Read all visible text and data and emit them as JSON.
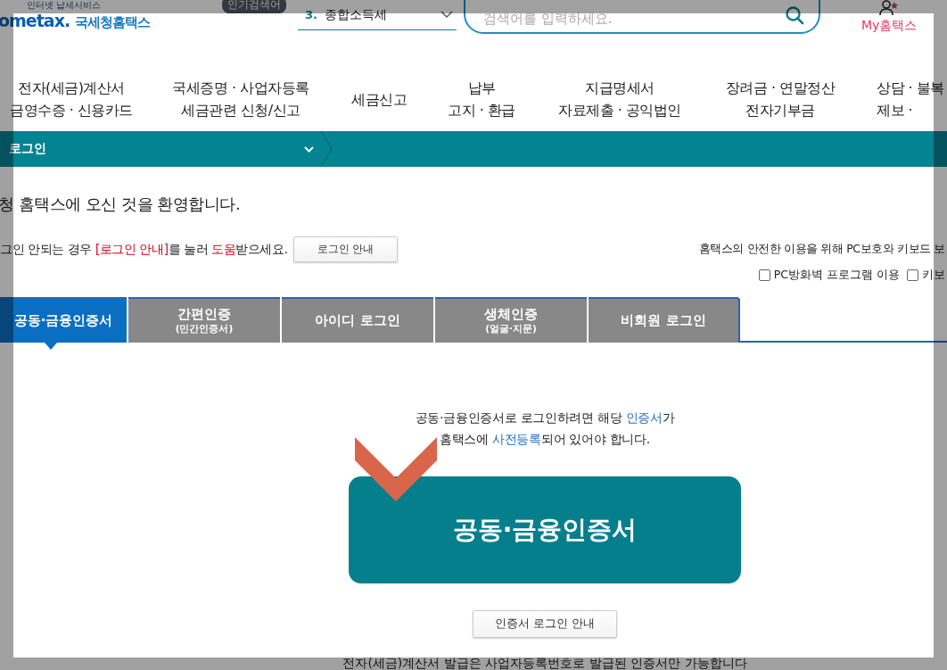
{
  "header": {
    "logo_tagline": "인터넷 납세서비스",
    "logo": "ometax.",
    "site_name": "국세청홈택스",
    "popular_tag": "인기검색어",
    "popular": {
      "rank": "3.",
      "term": "종합소득세"
    },
    "search": {
      "placeholder": "검색어를 입력하세요."
    },
    "my_link": "My홈택스"
  },
  "nav": [
    {
      "lines": [
        "전자(세금)계산서",
        "금영수증 · 신용카드"
      ]
    },
    {
      "lines": [
        "국세증명 · 사업자등록",
        "세금관련 신청/신고"
      ]
    },
    {
      "lines": [
        "세금신고"
      ]
    },
    {
      "lines": [
        "납부",
        "고지 · 환급"
      ]
    },
    {
      "lines": [
        "지급명세서",
        "자료제출 · 공익법인"
      ]
    },
    {
      "lines": [
        "장려금 · 연말정산",
        "전자기부금"
      ]
    },
    {
      "lines": [
        "상담 · 불복",
        "제보 ·"
      ]
    }
  ],
  "breadcrumb": {
    "label": "로그인"
  },
  "welcome": "청 홈택스에 오신 것을 환영합니다.",
  "help": {
    "segments": [
      {
        "text": "그인 안되는 경우 ",
        "highlight": false
      },
      {
        "text": "[로그인 안내]",
        "highlight": true
      },
      {
        "text": "를 눌러 ",
        "highlight": false
      },
      {
        "text": "도움",
        "highlight": true
      },
      {
        "text": "받으세요.",
        "highlight": false
      }
    ],
    "button": "로그인 안내"
  },
  "security": {
    "notice": "홈택스의 안전한 이용을 위해 PC보호와 키보드 보",
    "options": [
      {
        "label": "PC방화벽 프로그램 이용",
        "checked": false
      },
      {
        "label": "키보",
        "checked": false
      }
    ]
  },
  "tabs": [
    {
      "label": "공동·금융인증서",
      "selected": true
    },
    {
      "label": "간편인증",
      "sublabel": "(민간인증서)",
      "selected": false
    },
    {
      "label": "아이디 로그인",
      "selected": false
    },
    {
      "label": "생체인증",
      "sublabel": "(얼굴·지문)",
      "selected": false
    },
    {
      "label": "비회원 로그인",
      "selected": false
    }
  ],
  "instructions": [
    [
      {
        "text": "공동·금융인증서로 로그인하려면 해당 ",
        "highlight": false
      },
      {
        "text": "인증서",
        "highlight": true
      },
      {
        "text": "가",
        "highlight": false
      }
    ],
    [
      {
        "text": "홈택스에 ",
        "highlight": false
      },
      {
        "text": "사전등록",
        "highlight": true
      },
      {
        "text": "되어 있어야 합니다.",
        "highlight": false
      }
    ]
  ],
  "login_button": "공동·금융인증서",
  "guide_button": "인증서 로그인 안내",
  "footer_note": "전자(세금)계산서 발급은 사업자등록번호로 발급된 인증서만 가능합니다"
}
